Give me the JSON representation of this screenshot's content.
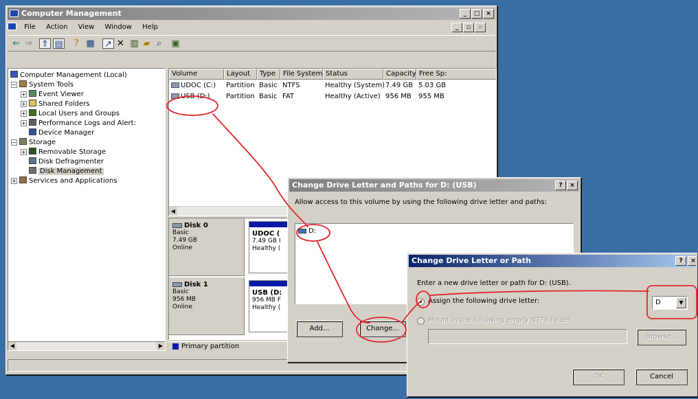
{
  "main_window": {
    "title": "Computer Management",
    "menus": [
      "File",
      "Action",
      "View",
      "Window",
      "Help"
    ],
    "toolbar_icons": [
      "back-icon",
      "forward-icon",
      "up-icon",
      "show-hide-tree-icon",
      "help-icon",
      "properties-icon",
      "export-icon",
      "delete-icon",
      "open-icon",
      "open-folder-icon",
      "search-icon",
      "refresh-icon"
    ]
  },
  "tree": [
    {
      "label": "Computer Management (Local)",
      "icon": "computer-icon"
    },
    {
      "label": "System Tools",
      "icon": "tools-icon"
    },
    {
      "label": "Event Viewer",
      "icon": "event-viewer-icon"
    },
    {
      "label": "Shared Folders",
      "icon": "shared-folder-icon"
    },
    {
      "label": "Local Users and Groups",
      "icon": "users-icon"
    },
    {
      "label": "Performance Logs and Alert:",
      "icon": "performance-icon"
    },
    {
      "label": "Device Manager",
      "icon": "device-manager-icon"
    },
    {
      "label": "Storage",
      "icon": "storage-icon"
    },
    {
      "label": "Removable Storage",
      "icon": "removable-storage-icon"
    },
    {
      "label": "Disk Defragmenter",
      "icon": "defragmenter-icon"
    },
    {
      "label": "Disk Management",
      "icon": "disk-management-icon"
    },
    {
      "label": "Services and Applications",
      "icon": "services-icon"
    }
  ],
  "volume_table": {
    "headers": [
      "Volume",
      "Layout",
      "Type",
      "File System",
      "Status",
      "Capacity",
      "Free Sp:"
    ],
    "rows": [
      [
        "UDOC (C:)",
        "Partition",
        "Basic",
        "NTFS",
        "Healthy (System)",
        "7.49 GB",
        "5.03 GB"
      ],
      [
        "USB (D:)",
        "Partition",
        "Basic",
        "FAT",
        "Healthy (Active)",
        "956 MB",
        "955 MB"
      ]
    ]
  },
  "disks": [
    {
      "name": "Disk 0",
      "type": "Basic",
      "size": "7.49 GB",
      "state": "Online",
      "vol_name": "UDOC (",
      "vol_size": "7.49 GB I",
      "vol_status": "Healthy ("
    },
    {
      "name": "Disk 1",
      "type": "Basic",
      "size": "956 MB",
      "state": "Online",
      "vol_name": "USB (D:",
      "vol_size": "956 MB F",
      "vol_status": "Healthy ("
    }
  ],
  "legend": {
    "primary": "Primary partition"
  },
  "dialog1": {
    "title": "Change Drive Letter and Paths for D: (USB)",
    "description": "Allow access to this volume by using the following drive letter and paths:",
    "list_item": "D:",
    "add_label": "Add...",
    "change_label": "Change..."
  },
  "dialog2": {
    "title": "Change Drive Letter or Path",
    "prompt": "Enter a new drive letter or path for D: (USB).",
    "assign_label": "Assign the following drive letter:",
    "drive_letter": "D",
    "mount_label": "Mount in the following empty NTFS folder:",
    "browse_label": "Browse...",
    "ok_label": "OK",
    "cancel_label": "Cancel"
  },
  "colors": {
    "desktop": "#3a6ea5",
    "active_title": "#0a246a",
    "inactive_title": "#808080",
    "annotation": "#e0262d",
    "primary_partition": "#0a1aa6"
  }
}
